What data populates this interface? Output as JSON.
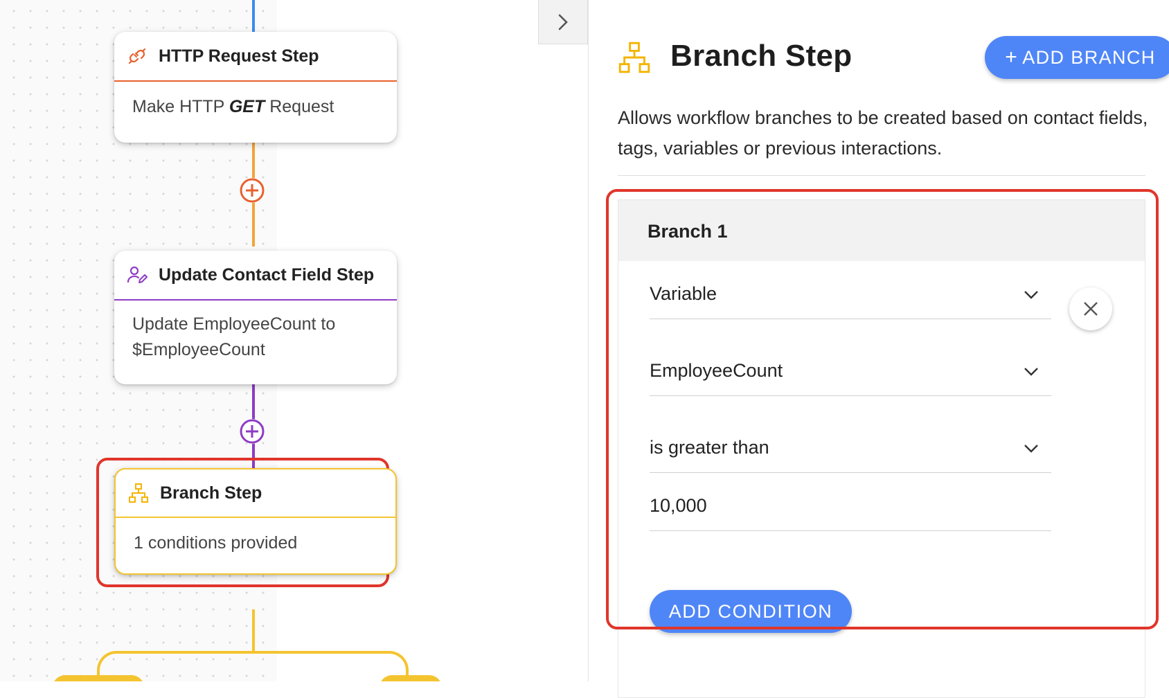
{
  "colors": {
    "accent_blue": "#4f86f7",
    "http_orange": "#e8602c",
    "contact_purple": "#8e3bc4",
    "branch_yellow": "#f4c430",
    "highlight_red": "#e0352b",
    "canvas_line_blue": "#3b8bf0"
  },
  "canvas": {
    "nodes": [
      {
        "icon": "http-request-icon",
        "title": "HTTP Request Step",
        "body_prefix": "Make HTTP",
        "body_method": "GET",
        "body_suffix": "Request"
      },
      {
        "icon": "contact-edit-icon",
        "title": "Update Contact Field Step",
        "body_line1": "Update EmployeeCount to",
        "body_line2": "$EmployeeCount"
      },
      {
        "icon": "branch-icon",
        "title": "Branch Step",
        "body": "1 conditions provided",
        "selected": true
      }
    ],
    "add_step_icons": [
      "add-step-icon",
      "add-step-icon"
    ]
  },
  "toggle": {
    "icon": "chevron-right-icon"
  },
  "panel": {
    "icon": "branch-icon",
    "title": "Branch Step",
    "add_branch_label": "ADD BRANCH",
    "add_branch_plus": "+",
    "description": "Allows workflow branches to be created based on contact fields, tags, variables or previous interactions.",
    "branches": [
      {
        "name": "Branch 1",
        "condition": {
          "source": "Variable",
          "field": "EmployeeCount",
          "operator": "is greater than",
          "value": "10,000"
        },
        "remove_icon": "close-icon",
        "add_condition_label": "ADD CONDITION"
      }
    ]
  }
}
